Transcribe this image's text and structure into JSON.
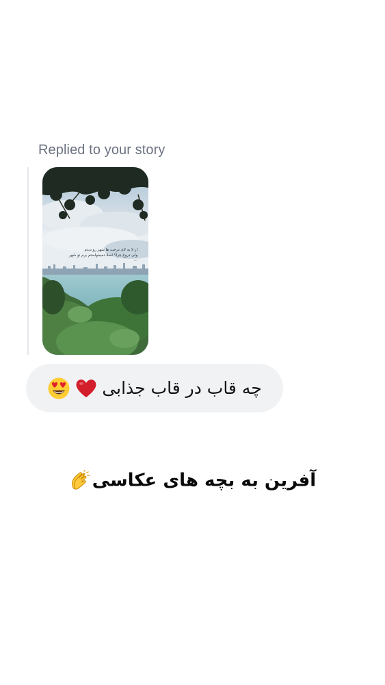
{
  "reply": {
    "label": "Replied to your story"
  },
  "story": {
    "caption_line1": "از لا به لای درخت ها شهر رو دیدم",
    "caption_line2": "ولی دروغ چرا؟ اصلا دمیخواستم برم تو شهر ..."
  },
  "message": {
    "text": "چه قاب در قاب جذابی",
    "emojis": [
      "heart-icon",
      "heart-eyes-icon"
    ]
  },
  "caption": {
    "text": "آفرین به بچه های عکاسی",
    "emoji": "clap-icon"
  },
  "colors": {
    "bubble": "#f1f2f4",
    "label": "#6b7280",
    "heart": "#d21f2b",
    "emoji_face": "#ffcc33"
  }
}
